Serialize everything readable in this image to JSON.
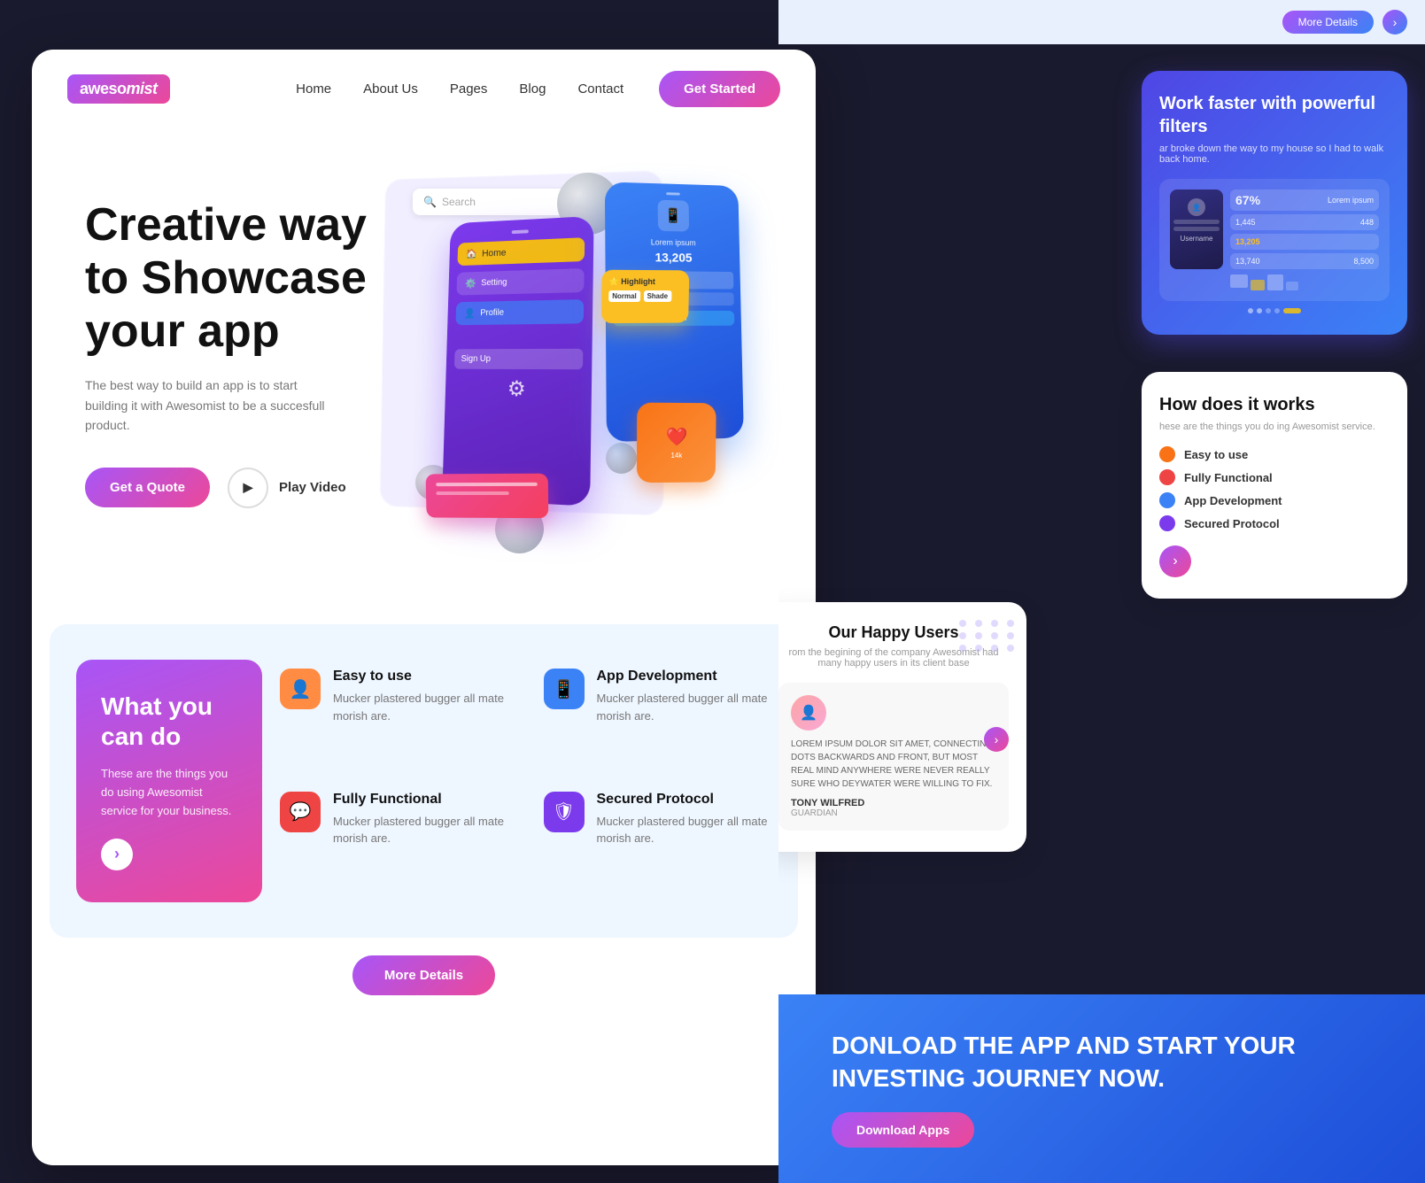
{
  "app": {
    "brand": "awesomist",
    "tagline_italic": "ist"
  },
  "navbar": {
    "logo_text": "awesomist",
    "links": [
      "Home",
      "About Us",
      "Pages",
      "Blog",
      "Contact"
    ],
    "cta_label": "Get Started"
  },
  "hero": {
    "title_line1": "Creative way",
    "title_line2": "to Showcase",
    "title_line3": "your app",
    "subtitle": "The best way to build an app is to start building it with Awesomist to be a succesfull product.",
    "btn_quote": "Get a Quote",
    "btn_play": "Play Video",
    "search_placeholder": "Search"
  },
  "features": {
    "card_title": "What you can do",
    "card_desc": "These are the things you do using Awesomist service for your business.",
    "items": [
      {
        "icon": "👤",
        "color": "orange",
        "title": "Easy to use",
        "desc": "Mucker plastered bugger all mate morish are."
      },
      {
        "icon": "📱",
        "color": "blue",
        "title": "App Development",
        "desc": "Mucker plastered bugger all mate morish are."
      },
      {
        "icon": "💬",
        "color": "red",
        "title": "Fully Functional",
        "desc": "Mucker plastered bugger all mate morish are."
      },
      {
        "icon": "🛡",
        "color": "purple",
        "title": "Secured Protocol",
        "desc": "Mucker plastered bugger all mate morish are."
      }
    ],
    "more_details_label": "More Details"
  },
  "right_panel": {
    "top_btn": "More Details",
    "card1": {
      "title": "Work faster with powerful filters",
      "subtitle": "ar broke down the way to my house so I had to walk back home.",
      "stats": [
        {
          "label": "67%",
          "sub": "Lorem ipsum"
        },
        {
          "label": "1,445",
          "sub": "448"
        },
        {
          "label": "13,740",
          "sub": "8,500"
        },
        {
          "label": "13,205",
          "sub": "Lorem ipsum"
        }
      ]
    },
    "card2": {
      "title": "How does it works",
      "subtitle": "hese are the things you do ing Awesomist service.",
      "items": [
        {
          "label": "Easy to use",
          "color": "#f97316"
        },
        {
          "label": "Fully Functional",
          "color": "#ef4444"
        },
        {
          "label": "App Development",
          "color": "#3b82f6"
        },
        {
          "label": "Secured Protocol",
          "color": "#7c3aed"
        }
      ]
    },
    "card3": {
      "title": "Our Happy Users",
      "subtitle": "rom the begining of the company Awesomist had many happy users in its client base",
      "testimonial_text": "LOREM IPSUM DOLOR SIT AMET, CONNECTING DOTS BACKWARDS AND FRONT, BUT MOST REAL MIND ANYWHERE WERE NEVER REALLY SURE WHO DEYWATER WERE WILLING TO FIX.",
      "user_name": "TONY WILFRED",
      "user_role": "GUARDIAN"
    },
    "card4": {
      "title_line1": "NLOAD THE APP AND START YOUR",
      "title_line2": "INVESTING JOURNEY NOW.",
      "btn_label": "Download Apps"
    }
  }
}
